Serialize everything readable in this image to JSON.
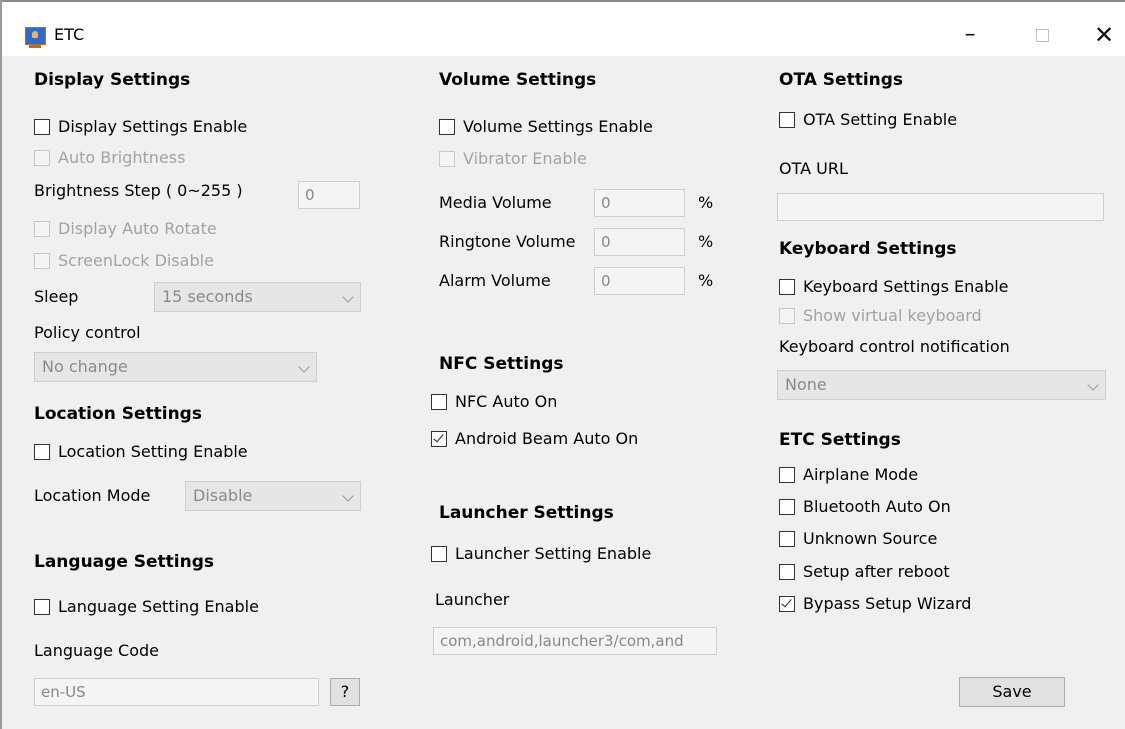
{
  "window": {
    "title": "ETC"
  },
  "display": {
    "header": "Display Settings",
    "enable": "Display Settings Enable",
    "auto_brightness": "Auto Brightness",
    "brightness_label": "Brightness Step ( 0~255 )",
    "brightness_value": "0",
    "auto_rotate": "Display Auto Rotate",
    "screenlock": "ScreenLock Disable",
    "sleep_label": "Sleep",
    "sleep_value": "15 seconds",
    "policy_label": "Policy control",
    "policy_value": "No change"
  },
  "location": {
    "header": "Location Settings",
    "enable": "Location Setting Enable",
    "mode_label": "Location Mode",
    "mode_value": "Disable"
  },
  "language": {
    "header": "Language Settings",
    "enable": "Language Setting Enable",
    "code_label": "Language Code",
    "code_value": "en-US",
    "help_label": "?"
  },
  "volume": {
    "header": "Volume Settings",
    "enable": "Volume Settings Enable",
    "vibrator": "Vibrator Enable",
    "media_label": "Media Volume",
    "media_value": "0",
    "ringtone_label": "Ringtone Volume",
    "ringtone_value": "0",
    "alarm_label": "Alarm Volume",
    "alarm_value": "0",
    "unit": "%"
  },
  "nfc": {
    "header": "NFC Settings",
    "auto_on": "NFC Auto On",
    "beam": "Android Beam Auto On"
  },
  "launcher": {
    "header": "Launcher Settings",
    "enable": "Launcher Setting Enable",
    "launcher_label": "Launcher",
    "launcher_value": "com,android,launcher3/com,and"
  },
  "ota": {
    "header": "OTA Settings",
    "enable": "OTA Setting Enable",
    "url_label": "OTA URL",
    "url_value": ""
  },
  "keyboard": {
    "header": "Keyboard Settings",
    "enable": "Keyboard Settings Enable",
    "show_virtual": "Show virtual keyboard",
    "notif_label": "Keyboard control notification",
    "notif_value": "None"
  },
  "etc": {
    "header": "ETC Settings",
    "airplane": "Airplane Mode",
    "bluetooth": "Bluetooth Auto On",
    "unknown": "Unknown Source",
    "setup_reboot": "Setup after reboot",
    "bypass": "Bypass Setup Wizard"
  },
  "actions": {
    "save": "Save"
  }
}
